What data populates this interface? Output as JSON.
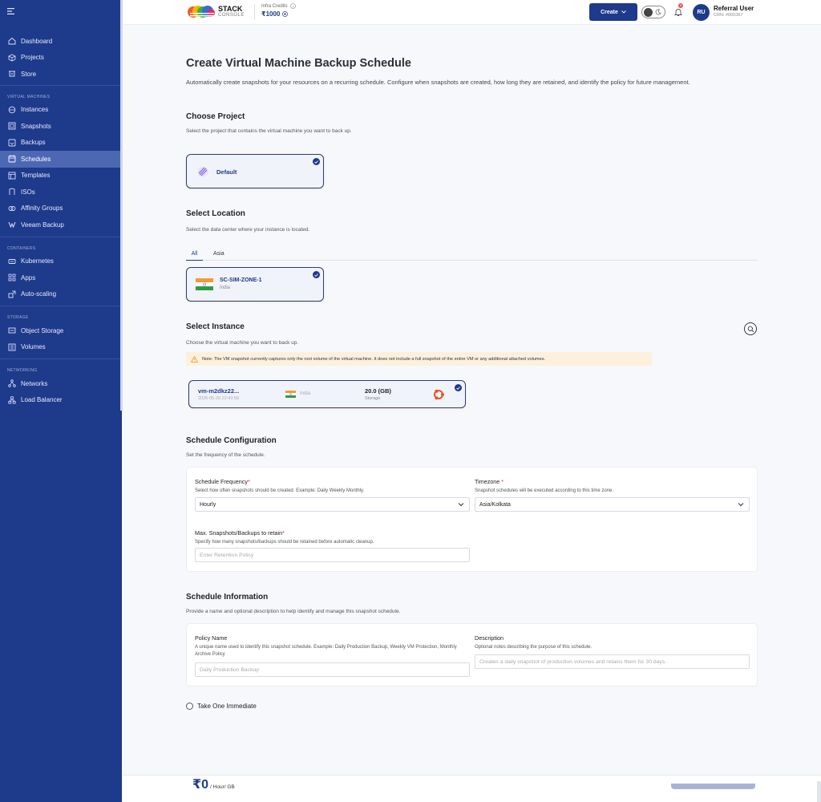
{
  "sidebar": {
    "main_items": [
      {
        "label": "Dashboard",
        "icon": "home-icon"
      },
      {
        "label": "Projects",
        "icon": "cube-icon"
      },
      {
        "label": "Store",
        "icon": "store-icon"
      }
    ],
    "sections": [
      {
        "heading": "VIRTUAL MACHINES",
        "items": [
          {
            "label": "Instances",
            "icon": "instances-icon"
          },
          {
            "label": "Snapshots",
            "icon": "snapshot-icon"
          },
          {
            "label": "Backups",
            "icon": "backup-icon"
          },
          {
            "label": "Schedules",
            "icon": "calendar-icon",
            "active": true
          },
          {
            "label": "Templates",
            "icon": "template-icon"
          },
          {
            "label": "ISOs",
            "icon": "iso-icon"
          },
          {
            "label": "Affinity Groups",
            "icon": "affinity-icon"
          },
          {
            "label": "Veeam Backup",
            "icon": "veeam-icon"
          }
        ]
      },
      {
        "heading": "CONTAINERS",
        "items": [
          {
            "label": "Kubernetes",
            "icon": "kubernetes-icon"
          },
          {
            "label": "Apps",
            "icon": "apps-icon"
          },
          {
            "label": "Auto-scaling",
            "icon": "autoscale-icon"
          }
        ]
      },
      {
        "heading": "STORAGE",
        "items": [
          {
            "label": "Object Storage",
            "icon": "object-storage-icon"
          },
          {
            "label": "Volumes",
            "icon": "volume-icon"
          }
        ]
      },
      {
        "heading": "NETWORKING",
        "items": [
          {
            "label": "Networks",
            "icon": "network-icon"
          },
          {
            "label": "Load Balancer",
            "icon": "load-balancer-icon"
          }
        ]
      }
    ]
  },
  "topbar": {
    "logo_line1": "STACK",
    "logo_line2": "CONSOLE",
    "credits_label": "Infra Credits",
    "credits_value": "₹1000",
    "create_label": "Create",
    "notification_count": "9",
    "avatar_initials": "RU",
    "user_name": "Referral User",
    "user_crn": "CRN: #001067"
  },
  "page": {
    "title": "Create Virtual Machine Backup Schedule",
    "intro": "Automatically create snapshots for your resources on a recurring schedule. Configure when snapshots are created, how long they are retained, and identify the policy for future management."
  },
  "project": {
    "title": "Choose Project",
    "desc": "Select the project that contains the virtual machine you want to back up.",
    "selected": "Default"
  },
  "location": {
    "title": "Select Location",
    "desc": "Select the data center where your instance is located.",
    "tabs": [
      "All",
      "Asia"
    ],
    "zone_name": "SC-SIM-ZONE-1",
    "zone_country": "India"
  },
  "instance": {
    "title": "Select Instance",
    "desc": "Choose the virtual machine you want to back up.",
    "note": "Note: The VM snapshot currently captures only the root volume of the virtual machine. It does not include a full snapshot of the entire VM or any additional attached volumes.",
    "name": "vm-m2dkz22...",
    "date": "2025-05-20 22:43:58",
    "country": "India",
    "storage_value": "20.0 (GB)",
    "storage_label": "Storage"
  },
  "schedule_config": {
    "title": "Schedule Configuration",
    "desc": "Set the frequency of the schedule.",
    "frequency_label": "Schedule Frequency",
    "frequency_help": "Select how often snapshots should be created. Example: Daily Weekly Monthly.",
    "frequency_value": "Hourly",
    "timezone_label": "Timezone",
    "timezone_help": "Snapshot schedules will be executed according to this time zone.",
    "timezone_value": "Asia/Kolkata",
    "retain_label": "Max. Snapshots/Backups to retain",
    "retain_help": "Specify how many snapshots/backups should be retained before automatic cleanup.",
    "retain_placeholder": "Enter Retention Policy"
  },
  "schedule_info": {
    "title": "Schedule Information",
    "desc": "Provide a name and optional description to help identify and manage this snapshot schedule.",
    "policy_label": "Policy Name",
    "policy_help": "A unique name used to identify this snapshot schedule. Example: Daily Production Backup, Weekly VM Protection, Monthly Archive Policy",
    "policy_placeholder": "Daily Production Backup",
    "description_label": "Description",
    "description_help": "Optional notes describing the purpose of this schedule.",
    "description_placeholder": "Creates a daily snapshot of production volumes and retains them for 30 days."
  },
  "immediate_label": "Take One Immediate",
  "footer": {
    "price": "₹0",
    "unit": "/ Hour/ GB"
  },
  "colors": {
    "sidebar_bg": "#1e3a8a",
    "accent": "#1e3a8a",
    "note_bg": "#fdf1dc"
  }
}
